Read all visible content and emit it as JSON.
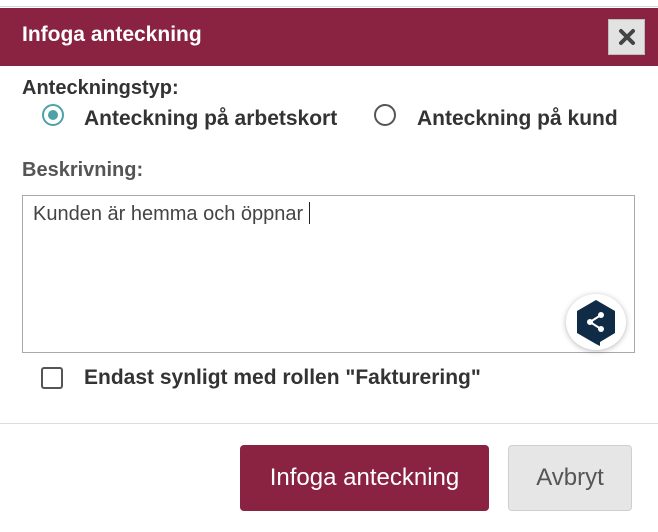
{
  "dialog": {
    "title": "Infoga anteckning",
    "close_icon": "close-x-icon"
  },
  "note_type": {
    "label": "Anteckningstyp:",
    "options": [
      {
        "label": "Anteckning på arbetskort",
        "selected": true
      },
      {
        "label": "Anteckning på kund",
        "selected": false
      }
    ]
  },
  "description": {
    "label": "Beskrivning:",
    "value": "Kunden är hemma och öppnar",
    "assist_icon": "share-hexagon-icon"
  },
  "visibility": {
    "label": "Endast synligt med rollen \"Fakturering\"",
    "checked": false
  },
  "buttons": {
    "submit_label": "Infoga anteckning",
    "cancel_label": "Avbryt"
  },
  "colors": {
    "accent": "#8a2342",
    "radio_selected": "#4da1a9"
  }
}
